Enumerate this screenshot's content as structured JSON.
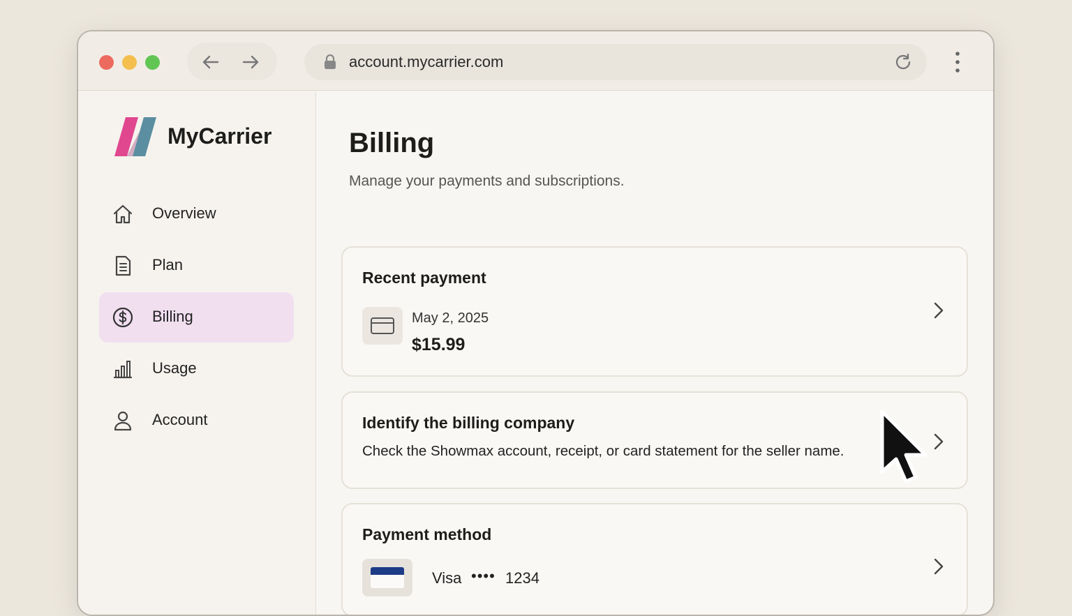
{
  "browser": {
    "url": "account.mycarrier.com",
    "back_icon": "arrow-left-icon",
    "forward_icon": "arrow-right-icon",
    "lock_icon": "lock-icon",
    "reload_icon": "reload-icon",
    "menu_icon": "kebab-menu-icon"
  },
  "brand": {
    "name": "MyCarrier",
    "logo_colors": [
      "#e0478f",
      "#5b8ea0"
    ]
  },
  "sidebar": {
    "items": [
      {
        "label": "Overview",
        "icon": "home-icon",
        "active": false
      },
      {
        "label": "Plan",
        "icon": "document-icon",
        "active": false
      },
      {
        "label": "Billing",
        "icon": "dollar-circle-icon",
        "active": true
      },
      {
        "label": "Usage",
        "icon": "bar-chart-icon",
        "active": false
      },
      {
        "label": "Account",
        "icon": "user-icon",
        "active": false
      }
    ],
    "active_color": "#f1dff0"
  },
  "page": {
    "title": "Billing",
    "subtitle": "Manage your payments and subscriptions."
  },
  "cards": {
    "recent_payment": {
      "title": "Recent payment",
      "date": "May 2, 2025",
      "amount": "$15.99",
      "icon": "credit-card-icon"
    },
    "identify": {
      "title": "Identify the billing company",
      "description": "Check the Showmax account, receipt, or card statement for the seller name."
    },
    "payment_method": {
      "title": "Payment method",
      "brand": "Visa",
      "masked": "••••",
      "last4": "1234",
      "icon": "visa-card-icon"
    }
  }
}
